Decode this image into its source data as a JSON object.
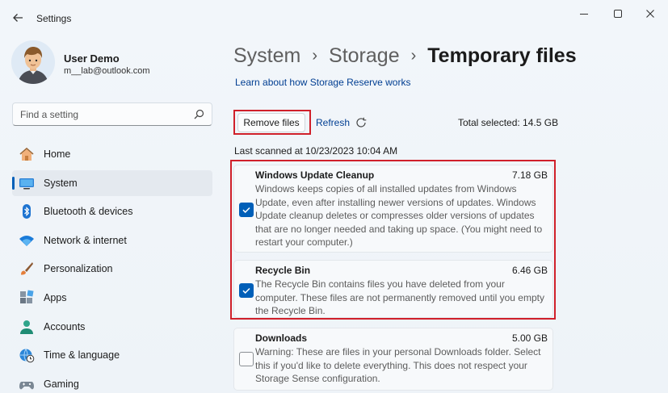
{
  "app": {
    "title": "Settings"
  },
  "window_controls": {
    "minimize": "minimize-icon",
    "maximize": "maximize-icon",
    "close": "close-icon"
  },
  "profile": {
    "name": "User Demo",
    "email": "m__lab@outlook.com"
  },
  "search": {
    "placeholder": "Find a setting",
    "value": ""
  },
  "sidebar": {
    "items": [
      {
        "label": "Home",
        "icon": "home-icon",
        "active": false
      },
      {
        "label": "System",
        "icon": "system-icon",
        "active": true
      },
      {
        "label": "Bluetooth & devices",
        "icon": "bluetooth-icon",
        "active": false
      },
      {
        "label": "Network & internet",
        "icon": "wifi-icon",
        "active": false
      },
      {
        "label": "Personalization",
        "icon": "brush-icon",
        "active": false
      },
      {
        "label": "Apps",
        "icon": "apps-icon",
        "active": false
      },
      {
        "label": "Accounts",
        "icon": "accounts-icon",
        "active": false
      },
      {
        "label": "Time & language",
        "icon": "globe-clock-icon",
        "active": false
      },
      {
        "label": "Gaming",
        "icon": "gamepad-icon",
        "active": false
      }
    ]
  },
  "breadcrumb": {
    "items": [
      "System",
      "Storage",
      "Temporary files"
    ]
  },
  "main": {
    "learn_link": "Learn about how Storage Reserve works",
    "remove_label": "Remove files",
    "refresh_label": "Refresh",
    "total_selected": "Total selected: 14.5 GB",
    "last_scanned": "Last scanned at 10/23/2023 10:04 AM",
    "items": [
      {
        "title": "Windows Update Cleanup",
        "size": "7.18 GB",
        "checked": true,
        "description": "Windows keeps copies of all installed updates from Windows Update, even after installing newer versions of updates. Windows Update cleanup deletes or compresses older versions of updates that are no longer needed and taking up space. (You might need to restart your computer.)"
      },
      {
        "title": "Recycle Bin",
        "size": "6.46 GB",
        "checked": true,
        "description": "The Recycle Bin contains files you have deleted from your computer. These files are not permanently removed until you empty the Recycle Bin."
      },
      {
        "title": "Downloads",
        "size": "5.00 GB",
        "checked": false,
        "description": "Warning: These are files in your personal Downloads folder. Select this if you'd like to delete everything. This does not respect your Storage Sense configuration."
      }
    ]
  },
  "colors": {
    "accent": "#005fb8",
    "highlight": "#d0202a",
    "link": "#003e92"
  }
}
